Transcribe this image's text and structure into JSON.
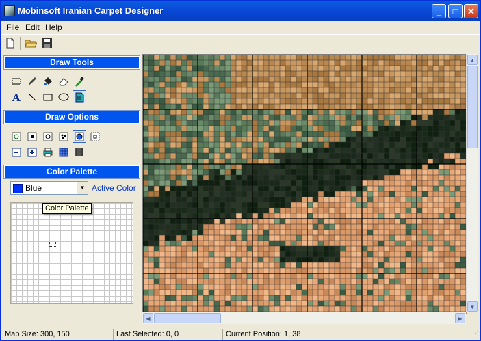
{
  "window": {
    "title": "Mobinsoft Iranian Carpet Designer"
  },
  "menu": {
    "items": [
      "File",
      "Edit",
      "Help"
    ]
  },
  "toolbar": {
    "buttons": [
      "new-file",
      "open-folder",
      "save-disk"
    ]
  },
  "draw_tools": {
    "header": "Draw Tools",
    "tools": [
      "select-rect",
      "pencil",
      "fill-bucket",
      "eraser",
      "eyedropper",
      "text",
      "line",
      "rectangle",
      "ellipse",
      "pattern-fill"
    ],
    "selected": "pattern-fill"
  },
  "draw_options": {
    "header": "Draw Options",
    "options": [
      "rotate",
      "square-dot",
      "circle-dot",
      "scatter",
      "circle-fill",
      "frame",
      "zoom-out",
      "zoom-in",
      "print",
      "grid",
      "lines"
    ],
    "selected": "circle-fill"
  },
  "color_palette": {
    "header": "Color Palette",
    "selected_color": "Blue",
    "selected_hex": "#0033ff",
    "active_label": "Active Color",
    "tooltip": "Color Palette"
  },
  "status": {
    "map_size": "Map Size:  300, 150",
    "last_selected": "Last Selected: 0, 0",
    "current_position": "Current Position: 1, 38"
  }
}
